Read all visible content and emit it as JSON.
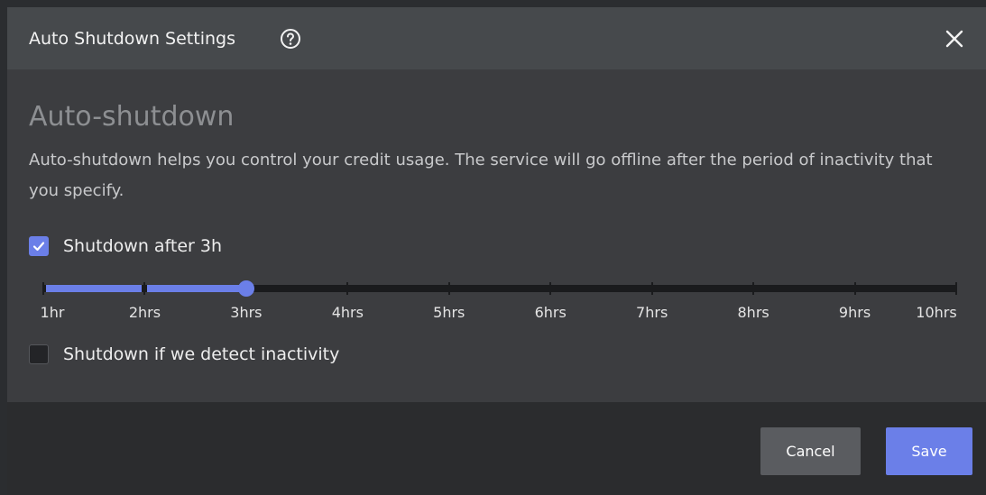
{
  "dialog": {
    "title": "Auto Shutdown Settings",
    "help_icon": "question-circle-icon",
    "close_icon": "close-x-icon"
  },
  "content": {
    "heading": "Auto-shutdown",
    "description": "Auto-shutdown helps you control your credit usage. The service will go offline after the period of inactivity that you specify."
  },
  "shutdown_after": {
    "label": "Shutdown after 3h",
    "checked": true
  },
  "slider": {
    "labels": [
      "1hr",
      "2hrs",
      "3hrs",
      "4hrs",
      "5hrs",
      "6hrs",
      "7hrs",
      "8hrs",
      "9hrs",
      "10hrs"
    ],
    "min_hours": 1,
    "max_hours": 10,
    "value_hours": 3
  },
  "shutdown_inactivity": {
    "label": "Shutdown if we detect inactivity",
    "checked": false
  },
  "footer": {
    "cancel_label": "Cancel",
    "save_label": "Save"
  },
  "colors": {
    "accent": "#6b7fe8",
    "header_bg": "#46494c",
    "body_bg": "#3c3d40",
    "footer_bg": "#2b2c2e"
  }
}
